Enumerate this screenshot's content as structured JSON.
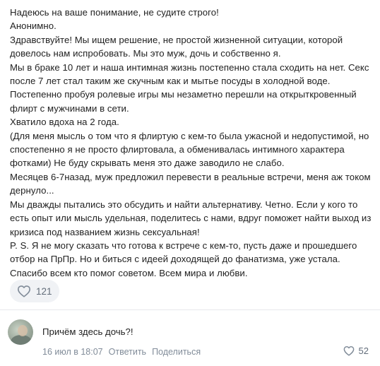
{
  "post": {
    "lines": [
      "Надеюсь на ваше понимание, не судите строго!",
      "Анонимно.",
      "Здравствуйте! Мы ищем решение, не простой жизненной ситуации, которой",
      "довелось нам испробовать. Мы это муж, дочь и собственно я.",
      "Мы в браке 10 лет и наша интимная жизнь постепенно стала сходить на нет. Секс",
      "после 7 лет стал таким же скучным как и мытье посуды в холодной воде.",
      "Постепенно пробуя ролевые игры мы незаметно перешли на открыткровенный",
      "флирт с мужчинами в сети.",
      "Хватило вдоха на 2 года.",
      "(Для меня мысль о том что я флиртую с кем-то была ужасной и недопустимой, но",
      "спостепенно я не просто флиртовала, а обменивалась интимного характера",
      "фотками) Не буду скрывать меня это даже заводило не слабо.",
      "Месяцев 6-7назад, муж предложил перевести в реальные встречи, меня аж током",
      "дернуло...",
      "Мы дважды пытались это обсудить и найти альтернативу. Четно. Если у кого то",
      "есть опыт или мысль удельная, поделитесь с нами, вдруг поможет найти выход из",
      "кризиса под названием жизнь сексуальная!",
      "P. S. Я не могу сказать что готова к встрече с кем-то, пусть даже и прошедшего",
      "отбор на ПрПр. Но и биться с идеей доходящей до фанатизма, уже устала.",
      "Спасибо всем кто помог советом. Всем мира и любви."
    ],
    "likes": "121",
    "like_icon": "heart-outline-icon"
  },
  "comment": {
    "text": "Причём здесь дочь?!",
    "date": "16 июл в 18:07",
    "reply_label": "Ответить",
    "share_label": "Поделиться",
    "likes": "52",
    "like_icon": "heart-outline-icon"
  },
  "colors": {
    "text": "#222222",
    "muted": "#818c99",
    "like_bg": "#f0f2f5",
    "icon": "#818c99"
  }
}
